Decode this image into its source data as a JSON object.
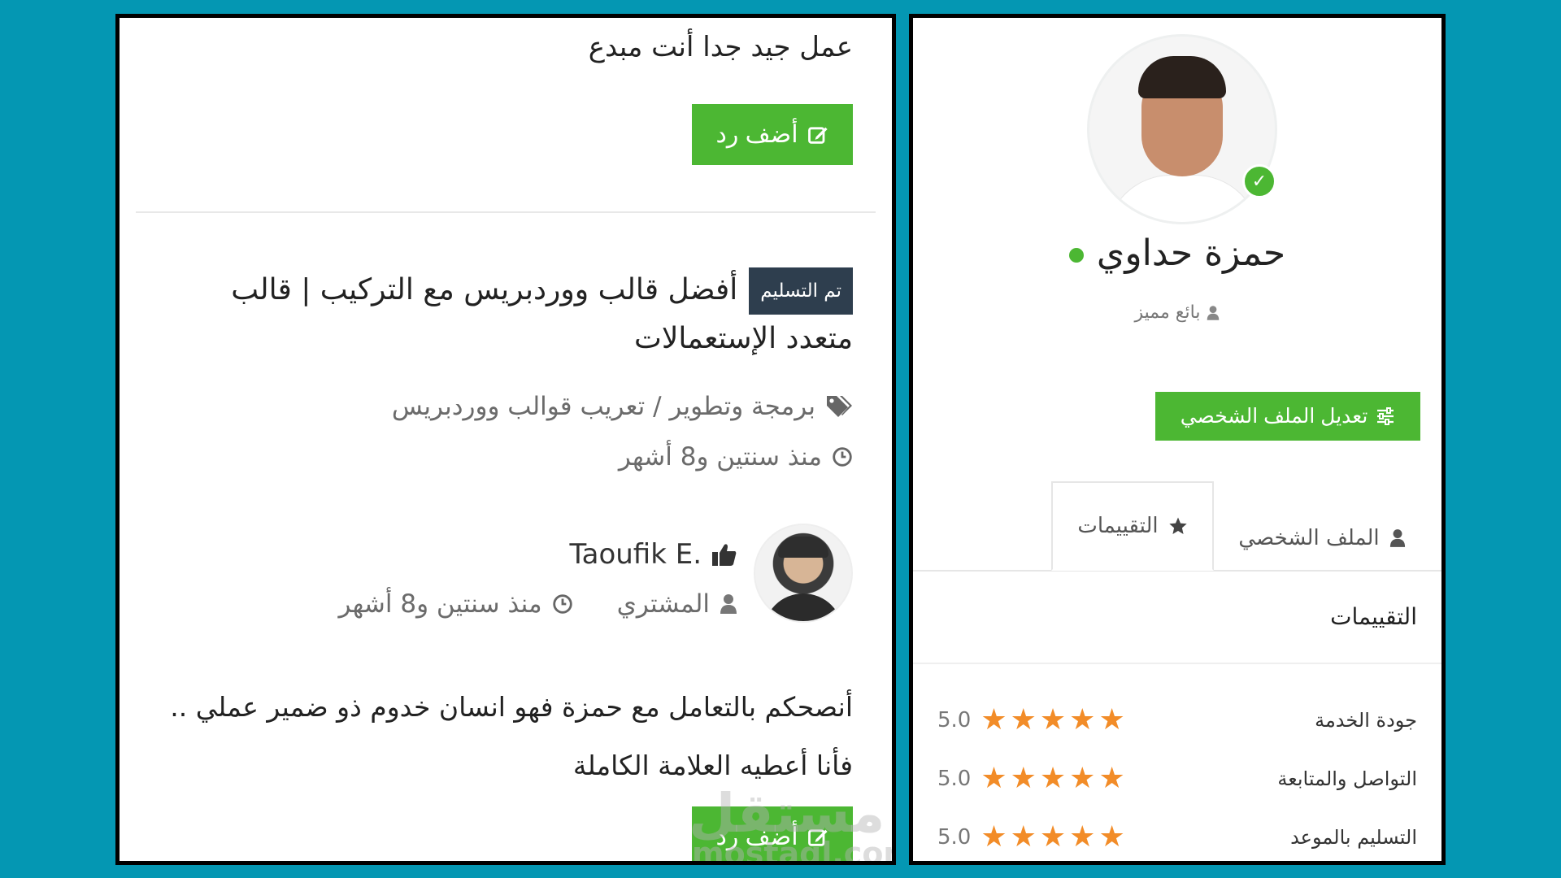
{
  "left": {
    "previous_comment": "عمل جيد جدا أنت مبدع",
    "reply_button": "أضف رد",
    "project": {
      "status_badge": "تم التسليم",
      "title": "أفضل قالب ووردبريس مع التركيب | قالب متعدد الإستعمالات",
      "category": "برمجة وتطوير / تعريب قوالب ووردبريس",
      "time": "منذ سنتين و8 أشهر"
    },
    "review": {
      "buyer_name": "Taoufik E.",
      "buyer_role": "المشتري",
      "time": "منذ سنتين و8 أشهر",
      "comment": "أنصحكم بالتعامل مع حمزة فهو انسان خدوم ذو ضمير عملي .. فأنا أعطيه العلامة الكاملة",
      "reply_button": "أضف رد"
    },
    "watermark": "مستقل",
    "watermark_sub": "mostaql.com"
  },
  "right": {
    "seller_name": "حمزة حداوي",
    "seller_role": "بائع مميز",
    "edit_profile_button": "تعديل الملف الشخصي",
    "tabs": [
      {
        "label": "الملف الشخصي",
        "icon": "user-icon",
        "active": false
      },
      {
        "label": "التقييمات",
        "icon": "star-icon",
        "active": true
      }
    ],
    "ratings_heading": "التقييمات",
    "ratings": [
      {
        "label": "جودة الخدمة",
        "value": "5.0",
        "stars": 5
      },
      {
        "label": "التواصل والمتابعة",
        "value": "5.0",
        "stars": 5
      },
      {
        "label": "التسليم بالموعد",
        "value": "5.0",
        "stars": 5
      }
    ]
  },
  "colors": {
    "background": "#0497b3",
    "accent_green": "#4cb733",
    "badge_dark": "#2e3e4e",
    "star_orange": "#f28c28"
  }
}
